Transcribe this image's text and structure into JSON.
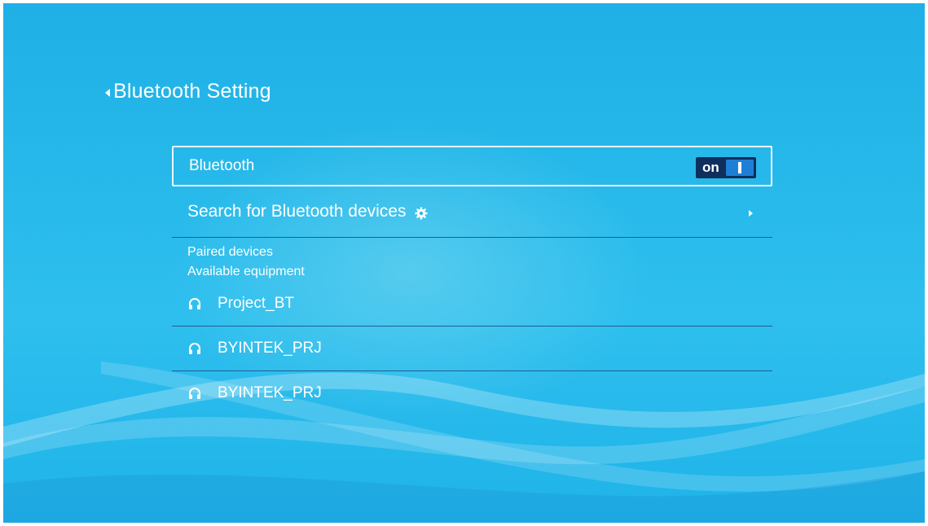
{
  "header": {
    "title": "Bluetooth Setting"
  },
  "bluetooth_row": {
    "label": "Bluetooth",
    "toggle_label": "on",
    "toggle_state": true
  },
  "search_row": {
    "label": "Search for Bluetooth devices",
    "icon": "gear-icon"
  },
  "sections": {
    "paired": "Paired devices",
    "available": "Available equipment"
  },
  "devices": [
    {
      "name": "Project_BT",
      "icon": "headphones-icon"
    },
    {
      "name": "BYINTEK_PRJ",
      "icon": "headphones-icon"
    },
    {
      "name": "BYINTEK_PRJ",
      "icon": "headphones-icon"
    }
  ],
  "colors": {
    "background": "#27b9ea",
    "toggle_bg": "#0f2f5c",
    "toggle_knob_bg": "#1f7fd6",
    "divider": "#1e5e95",
    "text": "#ffffff"
  }
}
